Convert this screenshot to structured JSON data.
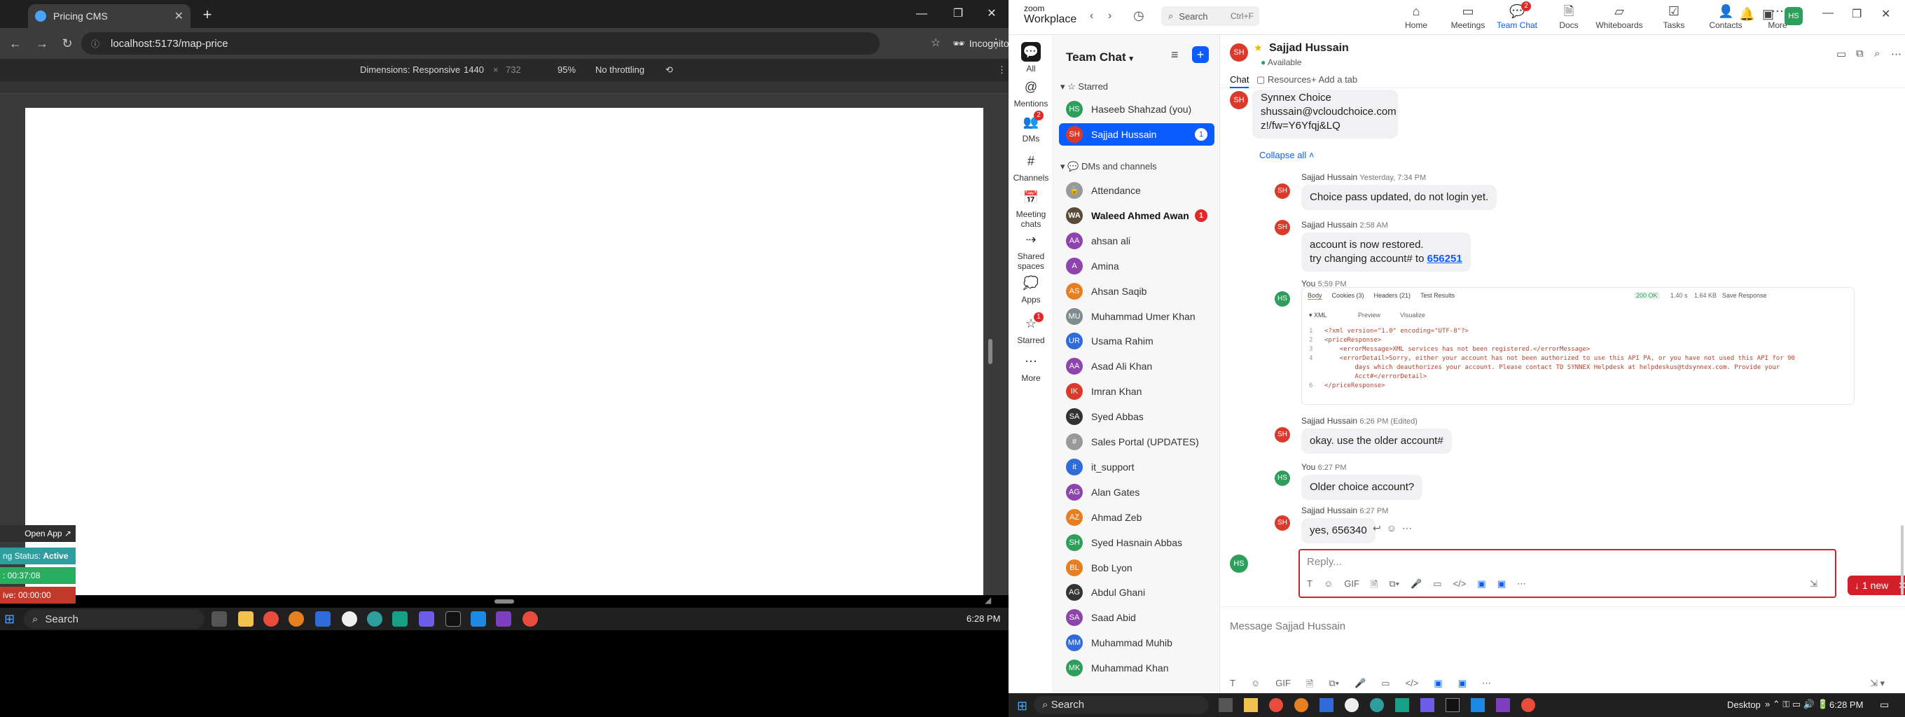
{
  "chrome": {
    "tab_title": "Pricing CMS",
    "url": "localhost:5173/map-price",
    "incognito_label": "Incognito",
    "devtools": {
      "dimensions_label": "Dimensions: Responsive",
      "width": "1440",
      "height": "732",
      "zoom": "95%",
      "throttling": "No throttling"
    }
  },
  "floating_widget": {
    "open_app": "Open App ↗",
    "status_prefix": "ng Status:",
    "status_value": "Active",
    "timer1": ": 00:37:08",
    "timer2": "ive: 00:00:00"
  },
  "left_taskbar": {
    "search_label": "Search",
    "time": "6:28 PM"
  },
  "zoom": {
    "brand_line1": "zoom",
    "brand_line2": "Workplace",
    "search_label": "Search",
    "search_shortcut": "Ctrl+F",
    "nav": [
      {
        "label": "Home",
        "icon": "home-icon"
      },
      {
        "label": "Meetings",
        "icon": "video-icon"
      },
      {
        "label": "Team Chat",
        "icon": "chat-icon",
        "badge": "2"
      },
      {
        "label": "Docs",
        "icon": "doc-icon"
      },
      {
        "label": "Whiteboards",
        "icon": "whiteboard-icon"
      },
      {
        "label": "Tasks",
        "icon": "tasks-icon"
      },
      {
        "label": "Contacts",
        "icon": "contacts-icon"
      },
      {
        "label": "More",
        "icon": "more-icon"
      }
    ],
    "user_initials": "HS",
    "rail": [
      {
        "label": "All"
      },
      {
        "label": "Mentions"
      },
      {
        "label": "DMs",
        "badge": "2"
      },
      {
        "label": "Channels"
      },
      {
        "label": "Meeting chats"
      },
      {
        "label": "Shared spaces"
      },
      {
        "label": "Apps"
      },
      {
        "label": "Starred",
        "badge": "1"
      },
      {
        "label": "More"
      }
    ],
    "list": {
      "title": "Team Chat",
      "starred_label": "Starred",
      "dms_label": "DMs and channels",
      "starred": [
        {
          "name": "Haseeb Shahzad (you)",
          "initials": "HS",
          "color": "#2e9e5b"
        },
        {
          "name": "Sajjad Hussain",
          "initials": "SH",
          "color": "#d93a2b",
          "count": "1",
          "selected": true
        }
      ],
      "items": [
        {
          "name": "Attendance",
          "initials": "🔒",
          "color": "#999"
        },
        {
          "name": "Waleed Ahmed Awan",
          "initials": "WA",
          "color": "#5a4a3a",
          "count": "1",
          "bold": true
        },
        {
          "name": "ahsan ali",
          "initials": "AA",
          "color": "#8e44ad"
        },
        {
          "name": "Amina",
          "initials": "A",
          "color": "#8e44ad"
        },
        {
          "name": "Ahsan Saqib",
          "initials": "AS",
          "color": "#e67e22"
        },
        {
          "name": "Muhammad Umer Khan",
          "initials": "MU",
          "color": "#7f8c8d"
        },
        {
          "name": "Usama Rahim",
          "initials": "UR",
          "color": "#2f6bd9"
        },
        {
          "name": "Asad Ali Khan",
          "initials": "AA",
          "color": "#8e44ad"
        },
        {
          "name": "Imran Khan",
          "initials": "IK",
          "color": "#d93a2b"
        },
        {
          "name": "Syed Abbas",
          "initials": "SA",
          "color": "#333"
        },
        {
          "name": "Sales Portal (UPDATES)",
          "initials": "#",
          "color": "#999"
        },
        {
          "name": "it_support",
          "initials": "it",
          "color": "#2f6bd9"
        },
        {
          "name": "Alan Gates",
          "initials": "AG",
          "color": "#8e44ad"
        },
        {
          "name": "Ahmad Zeb",
          "initials": "AZ",
          "color": "#e67e22"
        },
        {
          "name": "Syed Hasnain Abbas",
          "initials": "SH",
          "color": "#2e9e5b"
        },
        {
          "name": "Bob Lyon",
          "initials": "BL",
          "color": "#e67e22"
        },
        {
          "name": "Abdul Ghani",
          "initials": "AG",
          "color": "#333"
        },
        {
          "name": "Saad Abid",
          "initials": "SA",
          "color": "#8e44ad"
        },
        {
          "name": "Muhammad Muhib",
          "initials": "MM",
          "color": "#2f6bd9"
        },
        {
          "name": "Muhammad Khan",
          "initials": "MK",
          "color": "#2e9e5b"
        }
      ]
    },
    "chat": {
      "name": "Sajjad Hussain",
      "initials": "SH",
      "status": "Available",
      "tabs": [
        "Chat",
        "Resources",
        "+ Add a tab"
      ],
      "top_bubble": [
        "Synnex Choice",
        "shussain@vcloudchoice.com",
        "z!/fw=Y6Yfqj&LQ"
      ],
      "collapse": "Collapse all ˄",
      "messages": [
        {
          "who": "Sajjad Hussain",
          "time": "Yesterday, 7:34 PM",
          "text": "Choice pass updated, do not login yet."
        },
        {
          "who": "Sajjad Hussain",
          "time": "2:58 AM",
          "text": "account is now restored.",
          "text2": "try changing account# to ",
          "link": "656251"
        },
        {
          "who": "You",
          "time": "5:59 PM"
        },
        {
          "who": "Sajjad Hussain",
          "time": "6:26 PM (Edited)",
          "text": "okay. use the older account#"
        },
        {
          "who": "You",
          "time": "6:27 PM",
          "text": "Older choice account?"
        },
        {
          "who": "Sajjad Hussain",
          "time": "6:27 PM",
          "text": "yes, 656340"
        }
      ],
      "code": {
        "tabs": [
          "Body",
          "Cookies (3)",
          "Headers (21)",
          "Test Results"
        ],
        "status": "200 OK",
        "time": "1.40 s",
        "size": "1.64 KB",
        "save": "Save Response",
        "format": "XML",
        "preview": "Preview",
        "visualize": "Visualize",
        "lines": [
          "<?xml version=\"1.0\" encoding=\"UTF-8\"?>",
          "<priceResponse>",
          "    <errorMessage>XML services has not been registered.</errorMessage>",
          "    <errorDetail>Sorry, either your account has not been authorized to use this API PA, or you have not used this API for 90",
          "        days which deauthorizes your account. Please contact TD SYNNEX Helpdesk at helpdeskus@tdsynnex.com. Provide your",
          "        Acct#</errorDetail>",
          "</priceResponse>"
        ],
        "line_numbers": [
          "1",
          "2",
          "3",
          "4",
          "",
          "",
          "6"
        ]
      },
      "reply_placeholder": "Reply...",
      "new_pill": "1 new",
      "composer_placeholder": "Message Sajjad Hussain"
    },
    "taskbar": {
      "search_label": "Search",
      "desktop_label": "Desktop",
      "time": "6:28 PM"
    }
  }
}
